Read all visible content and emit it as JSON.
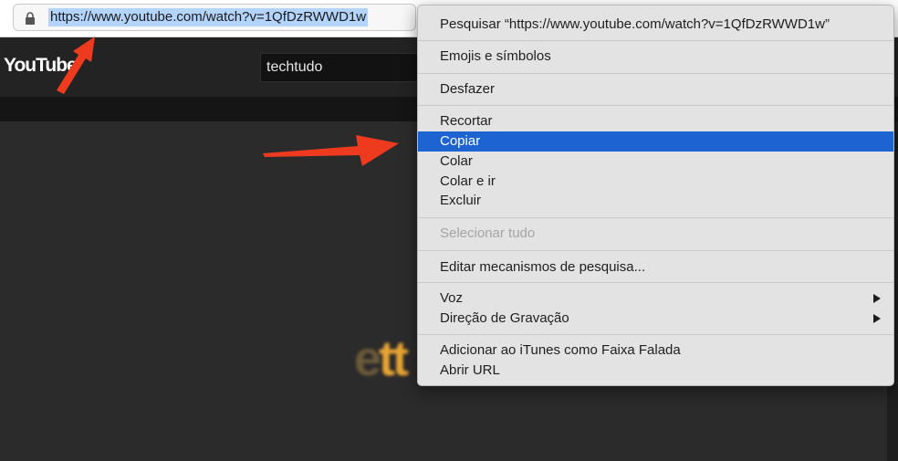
{
  "browser": {
    "url": "https://www.youtube.com/watch?v=1QfDzRWWD1w",
    "lock_icon": "lock-icon"
  },
  "youtube": {
    "logo_text": "YouTube",
    "search_value": "techtudo",
    "video_logo_text": "tt",
    "video_logo_prefix": "e"
  },
  "context_menu": {
    "search_item": "Pesquisar “https://www.youtube.com/watch?v=1QfDzRWWD1w”",
    "emojis": "Emojis e símbolos",
    "undo": "Desfazer",
    "cut": "Recortar",
    "copy": "Copiar",
    "paste": "Colar",
    "paste_go": "Colar e ir",
    "delete": "Excluir",
    "select_all": "Selecionar tudo",
    "edit_engines": "Editar mecanismos de pesquisa...",
    "voice": "Voz",
    "writing_direction": "Direção de Gravação",
    "add_itunes": "Adicionar ao iTunes como Faixa Falada",
    "open_url": "Abrir URL",
    "highlighted_item": "copy",
    "highlight_color": "#1e63d2"
  },
  "annotations": {
    "arrow_color": "#ee3b1f",
    "arrow_icon": "red-arrow-icon"
  }
}
